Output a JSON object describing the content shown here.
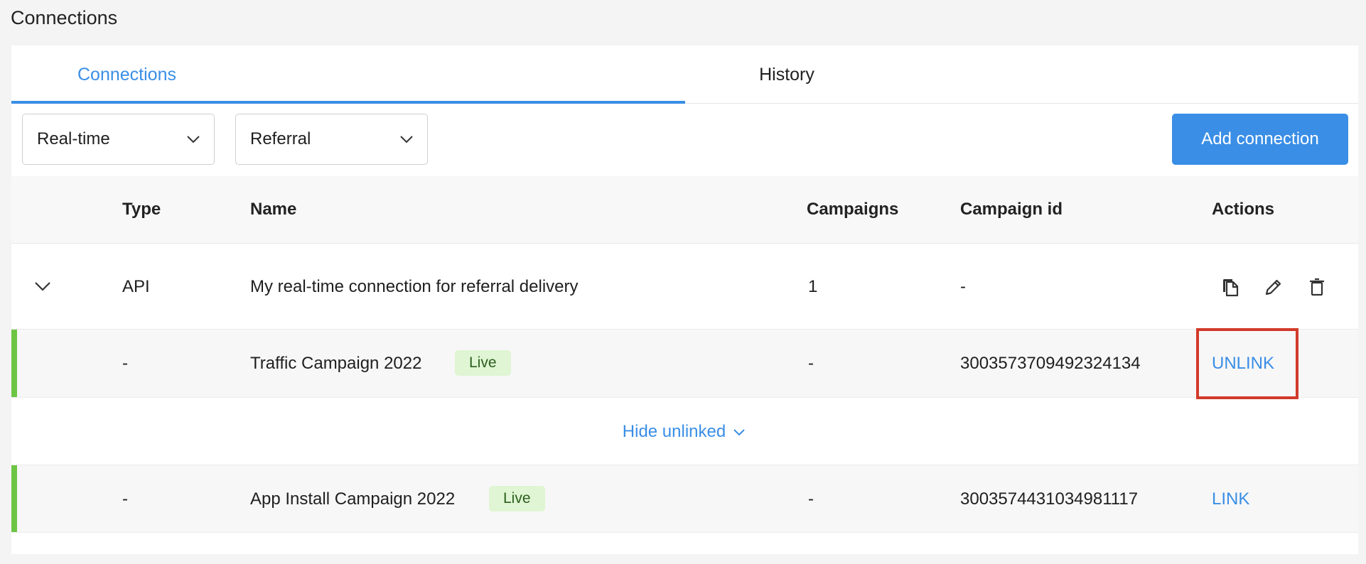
{
  "page": {
    "title": "Connections"
  },
  "tabs": [
    {
      "label": "Connections",
      "active": true
    },
    {
      "label": "History",
      "active": false
    }
  ],
  "filters": {
    "mode": {
      "value": "Real-time",
      "icon": "chevron-down-icon"
    },
    "type": {
      "value": "Referral",
      "icon": "chevron-down-icon"
    }
  },
  "add_button": {
    "label": "Add connection"
  },
  "table": {
    "headers": {
      "type": "Type",
      "name": "Name",
      "campaigns": "Campaigns",
      "campaign_id": "Campaign id",
      "actions": "Actions"
    },
    "connection": {
      "type": "API",
      "name": "My real-time connection for referral delivery",
      "campaigns": "1",
      "campaign_id": "-",
      "actions": [
        "copy-icon",
        "edit-icon",
        "delete-icon"
      ]
    },
    "linked_campaign": {
      "type": "-",
      "name": "Traffic Campaign 2022",
      "status": "Live",
      "campaigns": "-",
      "campaign_id": "3003573709492324134",
      "action": "UNLINK"
    },
    "toggle": {
      "label": "Hide unlinked",
      "icon": "chevron-down-icon"
    },
    "unlinked_campaign": {
      "type": "-",
      "name": "App Install Campaign 2022",
      "status": "Live",
      "campaigns": "-",
      "campaign_id": "3003574431034981117",
      "action": "LINK"
    }
  },
  "colors": {
    "accent": "#3a8ee6",
    "live_badge_bg": "#dff5d3",
    "status_bar": "#6cc644",
    "highlight": "#d23a2a"
  }
}
